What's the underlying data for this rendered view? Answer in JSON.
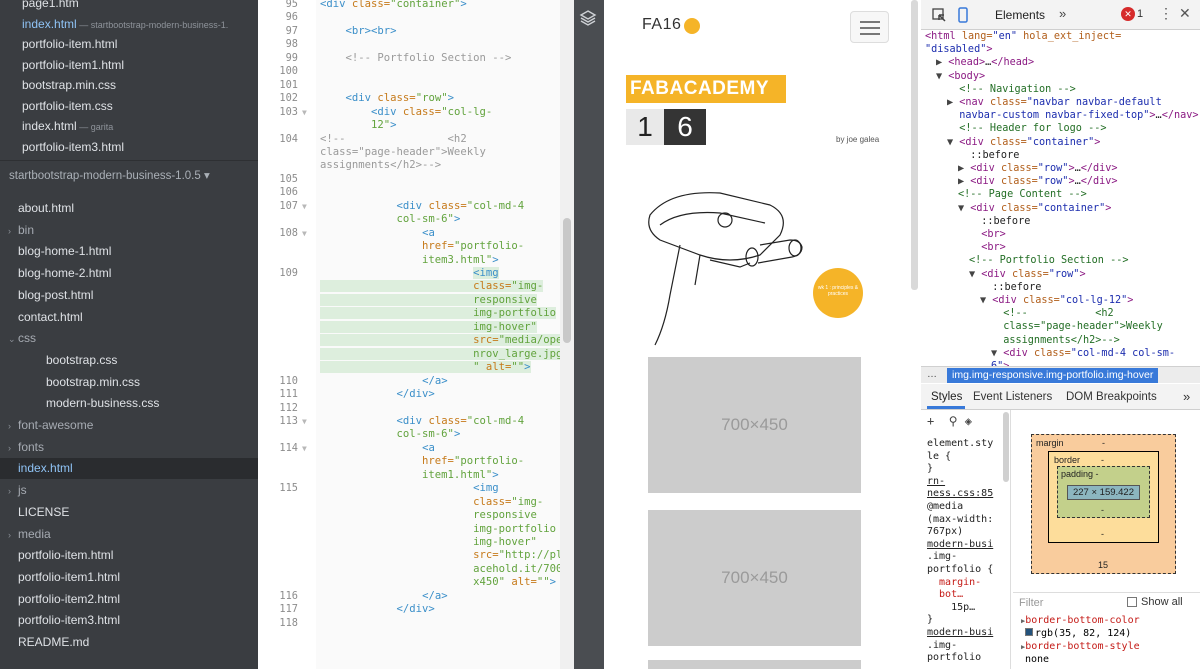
{
  "sidebar": {
    "top_files": [
      {
        "name": "page1.htm",
        "hint": ""
      },
      {
        "name": "index.html",
        "hint": "— startbootstrap-modern-business-1."
      },
      {
        "name": "portfolio-item.html",
        "hint": ""
      },
      {
        "name": "portfolio-item1.html",
        "hint": ""
      },
      {
        "name": "bootstrap.min.css",
        "hint": ""
      },
      {
        "name": "portfolio-item.css",
        "hint": ""
      },
      {
        "name": "index.html",
        "hint": "— garita"
      },
      {
        "name": "portfolio-item3.html",
        "hint": ""
      }
    ],
    "project": "startbootstrap-modern-business-1.0.5 ▾",
    "tree": [
      {
        "name": "about.html",
        "type": "file"
      },
      {
        "name": "bin",
        "type": "dir"
      },
      {
        "name": "blog-home-1.html",
        "type": "file"
      },
      {
        "name": "blog-home-2.html",
        "type": "file"
      },
      {
        "name": "blog-post.html",
        "type": "file"
      },
      {
        "name": "contact.html",
        "type": "file"
      },
      {
        "name": "css",
        "type": "dir-open"
      },
      {
        "name": "bootstrap.css",
        "type": "sub"
      },
      {
        "name": "bootstrap.min.css",
        "type": "sub"
      },
      {
        "name": "modern-business.css",
        "type": "sub"
      },
      {
        "name": "font-awesome",
        "type": "dir"
      },
      {
        "name": "fonts",
        "type": "dir"
      },
      {
        "name": "index.html",
        "type": "active"
      },
      {
        "name": "js",
        "type": "dir"
      },
      {
        "name": "LICENSE",
        "type": "file"
      },
      {
        "name": "media",
        "type": "dir"
      },
      {
        "name": "portfolio-item.html",
        "type": "file"
      },
      {
        "name": "portfolio-item1.html",
        "type": "file"
      },
      {
        "name": "portfolio-item2.html",
        "type": "file"
      },
      {
        "name": "portfolio-item3.html",
        "type": "file"
      },
      {
        "name": "README.md",
        "type": "file"
      }
    ]
  },
  "editor": {
    "lines": [
      {
        "n": "95",
        "code": [
          [
            "t",
            "<div "
          ],
          [
            "a",
            "class="
          ],
          [
            "s",
            "\"container\""
          ],
          [
            "t",
            ">"
          ]
        ]
      },
      {
        "n": "96",
        "code": []
      },
      {
        "n": "97",
        "code": [
          [
            "p",
            "    "
          ],
          [
            "t",
            "<br><br>"
          ]
        ]
      },
      {
        "n": "98",
        "code": []
      },
      {
        "n": "99",
        "code": [
          [
            "p",
            "    "
          ],
          [
            "c",
            "<!-- Portfolio Section -->"
          ]
        ]
      },
      {
        "n": "100",
        "code": []
      },
      {
        "n": "101",
        "code": []
      },
      {
        "n": "102",
        "code": [
          [
            "p",
            "    "
          ],
          [
            "t",
            "<div "
          ],
          [
            "a",
            "class="
          ],
          [
            "s",
            "\"row\""
          ],
          [
            "t",
            ">"
          ]
        ]
      },
      {
        "n": "103",
        "code": [
          [
            "p",
            "        "
          ],
          [
            "t",
            "<div "
          ],
          [
            "a",
            "class="
          ],
          [
            "s",
            "\"col-lg-"
          ]
        ]
      },
      {
        "n": "",
        "code": [
          [
            "s",
            "        12\""
          ],
          [
            "t",
            ">"
          ]
        ]
      },
      {
        "n": "104",
        "code": [
          [
            "c",
            "<!--                <h2"
          ]
        ]
      },
      {
        "n": "",
        "code": [
          [
            "c",
            "class=\"page-header\">Weekly"
          ]
        ]
      },
      {
        "n": "",
        "code": [
          [
            "c",
            "assignments</h2>-->"
          ]
        ]
      },
      {
        "n": "105",
        "code": []
      },
      {
        "n": "106",
        "code": []
      },
      {
        "n": "107",
        "code": [
          [
            "p",
            "            "
          ],
          [
            "t",
            "<div "
          ],
          [
            "a",
            "class="
          ],
          [
            "s",
            "\"col-md-4"
          ]
        ]
      },
      {
        "n": "",
        "code": [
          [
            "s",
            "            col-sm-6\""
          ],
          [
            "t",
            ">"
          ]
        ]
      },
      {
        "n": "108",
        "code": [
          [
            "p",
            "                "
          ],
          [
            "t",
            "<a"
          ]
        ]
      },
      {
        "n": "",
        "code": [
          [
            "a",
            "                href="
          ],
          [
            "s",
            "\"portfolio-"
          ]
        ]
      },
      {
        "n": "",
        "code": [
          [
            "s",
            "                item3.html\""
          ],
          [
            "t",
            ">"
          ]
        ]
      },
      {
        "n": "109",
        "code": [
          [
            "p",
            "                        "
          ],
          [
            "t",
            "<img"
          ]
        ]
      },
      {
        "n": "",
        "code": [
          [
            "a",
            "                        class="
          ],
          [
            "s",
            "\"img-"
          ]
        ]
      },
      {
        "n": "",
        "code": [
          [
            "s",
            "                        responsive"
          ]
        ]
      },
      {
        "n": "",
        "code": [
          [
            "s",
            "                        img-portfolio"
          ]
        ]
      },
      {
        "n": "",
        "code": [
          [
            "s",
            "                        img-hover\""
          ]
        ]
      },
      {
        "n": "",
        "code": [
          [
            "a",
            "                        src="
          ],
          [
            "s",
            "\"media/ope"
          ]
        ]
      },
      {
        "n": "",
        "code": [
          [
            "s",
            "                        nrov_large.jpg"
          ]
        ]
      },
      {
        "n": "",
        "code": [
          [
            "s",
            "                        \" "
          ],
          [
            "a",
            "alt="
          ],
          [
            "s",
            "\"\""
          ],
          [
            "t",
            ">"
          ]
        ]
      },
      {
        "n": "110",
        "code": [
          [
            "p",
            "                "
          ],
          [
            "t",
            "</a>"
          ]
        ]
      },
      {
        "n": "111",
        "code": [
          [
            "p",
            "            "
          ],
          [
            "t",
            "</div>"
          ]
        ]
      },
      {
        "n": "112",
        "code": []
      },
      {
        "n": "113",
        "code": [
          [
            "p",
            "            "
          ],
          [
            "t",
            "<div "
          ],
          [
            "a",
            "class="
          ],
          [
            "s",
            "\"col-md-4"
          ]
        ]
      },
      {
        "n": "",
        "code": [
          [
            "s",
            "            col-sm-6\""
          ],
          [
            "t",
            ">"
          ]
        ]
      },
      {
        "n": "114",
        "code": [
          [
            "p",
            "                "
          ],
          [
            "t",
            "<a"
          ]
        ]
      },
      {
        "n": "",
        "code": [
          [
            "a",
            "                href="
          ],
          [
            "s",
            "\"portfolio-"
          ]
        ]
      },
      {
        "n": "",
        "code": [
          [
            "s",
            "                item1.html\""
          ],
          [
            "t",
            ">"
          ]
        ]
      },
      {
        "n": "115",
        "code": [
          [
            "p",
            "                        "
          ],
          [
            "t",
            "<img"
          ]
        ]
      },
      {
        "n": "",
        "code": [
          [
            "a",
            "                        class="
          ],
          [
            "s",
            "\"img-"
          ]
        ]
      },
      {
        "n": "",
        "code": [
          [
            "s",
            "                        responsive"
          ]
        ]
      },
      {
        "n": "",
        "code": [
          [
            "s",
            "                        img-portfolio"
          ]
        ]
      },
      {
        "n": "",
        "code": [
          [
            "s",
            "                        img-hover\""
          ]
        ]
      },
      {
        "n": "",
        "code": [
          [
            "a",
            "                        src="
          ],
          [
            "s",
            "\"http://pl"
          ]
        ]
      },
      {
        "n": "",
        "code": [
          [
            "s",
            "                        acehold.it/700"
          ]
        ]
      },
      {
        "n": "",
        "code": [
          [
            "s",
            "                        x450\" "
          ],
          [
            "a",
            "alt="
          ],
          [
            "s",
            "\"\""
          ],
          [
            "t",
            ">"
          ]
        ]
      },
      {
        "n": "116",
        "code": [
          [
            "p",
            "                "
          ],
          [
            "t",
            "</a>"
          ]
        ]
      },
      {
        "n": "117",
        "code": [
          [
            "p",
            "            "
          ],
          [
            "t",
            "</div>"
          ]
        ]
      },
      {
        "n": "118",
        "code": []
      }
    ]
  },
  "device": {
    "brand": "FA16",
    "logo_word": "FABACADEMY",
    "logo_digit1": "1",
    "logo_digit2": "6",
    "byline": "by joe galea",
    "badge_text": "wk 1 : principles & practices",
    "placeholder1": "700×450",
    "placeholder2": "700×450"
  },
  "devtools": {
    "tab_elements": "Elements",
    "error_count": "1",
    "dom_lines": [
      {
        "i": 0,
        "parts": [
          [
            "tg",
            "<html "
          ],
          [
            "at",
            "lang="
          ],
          [
            "av",
            "\"en\" "
          ],
          [
            "at",
            "hola_ext_inject="
          ]
        ]
      },
      {
        "i": 0,
        "parts": [
          [
            "av",
            "\"disabled\""
          ],
          [
            "tg",
            ">"
          ]
        ]
      },
      {
        "i": 1,
        "parts": [
          [
            "ar",
            "▶ "
          ],
          [
            "tg",
            "<head>"
          ],
          [
            "tx",
            "…"
          ],
          [
            "tg",
            "</head>"
          ]
        ]
      },
      {
        "i": 1,
        "parts": [
          [
            "ar",
            "▼ "
          ],
          [
            "tg",
            "<body>"
          ]
        ]
      },
      {
        "i": 2,
        "parts": [
          [
            "cm",
            "  <!-- Navigation -->"
          ]
        ]
      },
      {
        "i": 2,
        "parts": [
          [
            "ar",
            "▶ "
          ],
          [
            "tg",
            "<nav "
          ],
          [
            "at",
            "class="
          ],
          [
            "av",
            "\"navbar navbar-default"
          ]
        ]
      },
      {
        "i": 2,
        "parts": [
          [
            "av",
            "  navbar-custom navbar-fixed-top\""
          ],
          [
            "tg",
            ">"
          ],
          [
            "tx",
            "…"
          ],
          [
            "tg",
            "</nav>"
          ]
        ]
      },
      {
        "i": 2,
        "parts": [
          [
            "cm",
            "  <!-- Header for logo -->"
          ]
        ]
      },
      {
        "i": 2,
        "parts": [
          [
            "ar",
            "▼ "
          ],
          [
            "tg",
            "<div "
          ],
          [
            "at",
            "class="
          ],
          [
            "av",
            "\"container\""
          ],
          [
            "tg",
            ">"
          ]
        ]
      },
      {
        "i": 3,
        "parts": [
          [
            "tx",
            "  ::before"
          ]
        ]
      },
      {
        "i": 3,
        "parts": [
          [
            "ar",
            "▶ "
          ],
          [
            "tg",
            "<div "
          ],
          [
            "at",
            "class="
          ],
          [
            "av",
            "\"row\""
          ],
          [
            "tg",
            ">"
          ],
          [
            "tx",
            "…"
          ],
          [
            "tg",
            "</div>"
          ]
        ]
      },
      {
        "i": 3,
        "parts": [
          [
            "ar",
            "▶ "
          ],
          [
            "tg",
            "<div "
          ],
          [
            "at",
            "class="
          ],
          [
            "av",
            "\"row\""
          ],
          [
            "tg",
            ">"
          ],
          [
            "tx",
            "…"
          ],
          [
            "tg",
            "</div>"
          ]
        ]
      },
      {
        "i": 3,
        "parts": [
          [
            "cm",
            "<!-- Page Content -->"
          ]
        ]
      },
      {
        "i": 3,
        "parts": [
          [
            "ar",
            "▼ "
          ],
          [
            "tg",
            "<div "
          ],
          [
            "at",
            "class="
          ],
          [
            "av",
            "\"container\""
          ],
          [
            "tg",
            ">"
          ]
        ]
      },
      {
        "i": 4,
        "parts": [
          [
            "tx",
            "  ::before"
          ]
        ]
      },
      {
        "i": 4,
        "parts": [
          [
            "tg",
            "  <br>"
          ]
        ]
      },
      {
        "i": 4,
        "parts": [
          [
            "tg",
            "  <br>"
          ]
        ]
      },
      {
        "i": 4,
        "parts": [
          [
            "cm",
            "<!-- Portfolio Section -->"
          ]
        ]
      },
      {
        "i": 4,
        "parts": [
          [
            "ar",
            "▼ "
          ],
          [
            "tg",
            "<div "
          ],
          [
            "at",
            "class="
          ],
          [
            "av",
            "\"row\""
          ],
          [
            "tg",
            ">"
          ]
        ]
      },
      {
        "i": 5,
        "parts": [
          [
            "tx",
            "  ::before"
          ]
        ]
      },
      {
        "i": 5,
        "parts": [
          [
            "ar",
            "▼ "
          ],
          [
            "tg",
            "<div "
          ],
          [
            "at",
            "class="
          ],
          [
            "av",
            "\"col-lg-12\""
          ],
          [
            "tg",
            ">"
          ]
        ]
      },
      {
        "i": 6,
        "parts": [
          [
            "cm",
            "  <!--           <h2"
          ]
        ]
      },
      {
        "i": 6,
        "parts": [
          [
            "cm",
            "  class=\"page-header\">Weekly"
          ]
        ]
      },
      {
        "i": 6,
        "parts": [
          [
            "cm",
            "  assignments</h2>-->"
          ]
        ]
      },
      {
        "i": 6,
        "parts": [
          [
            "ar",
            "▼ "
          ],
          [
            "tg",
            "<div "
          ],
          [
            "at",
            "class="
          ],
          [
            "av",
            "\"col-md-4 col-sm-"
          ]
        ]
      },
      {
        "i": 6,
        "parts": [
          [
            "av",
            "6\""
          ],
          [
            "tg",
            ">"
          ]
        ]
      }
    ],
    "breadcrumb_dots": "…",
    "breadcrumb": "img.img-responsive.img-portfolio.img-hover",
    "tab_styles": "Styles",
    "tab_listeners": "Event Listeners",
    "tab_dom_bp": "DOM Breakpoints",
    "style_lines": [
      {
        "cls": "sel",
        "text": "element.sty"
      },
      {
        "cls": "sel",
        "text": "le {"
      },
      {
        "cls": "sel",
        "text": "}"
      },
      {
        "cls": "lk",
        "text": "rn-"
      },
      {
        "cls": "lk",
        "text": "ness.css:85"
      },
      {
        "cls": "sel",
        "text": "@media"
      },
      {
        "cls": "sel",
        "text": "(max-width:"
      },
      {
        "cls": "sel",
        "text": "767px)"
      },
      {
        "cls": "lk",
        "text": "modern-busi"
      },
      {
        "cls": "sel",
        "text": ".img-"
      },
      {
        "cls": "sel",
        "text": "portfolio {"
      },
      {
        "cls": "prop",
        "text": "  margin-"
      },
      {
        "cls": "prop",
        "text": "  bot…"
      },
      {
        "cls": "val",
        "text": "    15p…"
      },
      {
        "cls": "sel",
        "text": "}"
      },
      {
        "cls": "lk",
        "text": "modern-busi"
      },
      {
        "cls": "sel",
        "text": ".img-"
      },
      {
        "cls": "sel",
        "text": "portfolio"
      }
    ],
    "box_model": {
      "margin_label": "margin",
      "margin_top": "-",
      "margin_bottom": "15",
      "border_label": "border",
      "border_top": "-",
      "padding_label": "padding -",
      "padding_bottom": "-",
      "border_bottom": "-",
      "content": "227 × 159.422"
    },
    "filter_placeholder": "Filter",
    "show_all": "Show all",
    "computed": [
      {
        "prop": "border-bottom-color",
        "val": "rgb(35, 82, 124)",
        "swatch": "#23527c"
      },
      {
        "prop": "border-bottom-style",
        "val": "none"
      }
    ]
  }
}
